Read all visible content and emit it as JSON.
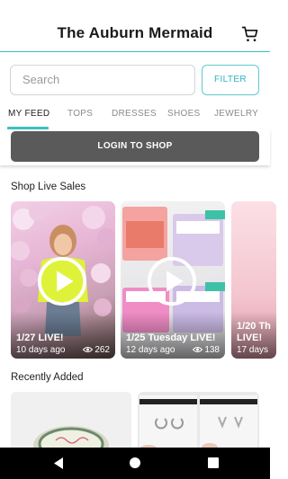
{
  "header": {
    "title": "The Auburn Mermaid",
    "cart_icon": "cart-icon"
  },
  "search": {
    "placeholder": "Search",
    "filter_label": "FILTER"
  },
  "tabs": [
    {
      "label": "MY FEED",
      "active": true
    },
    {
      "label": "TOPS",
      "active": false
    },
    {
      "label": "DRESSES",
      "active": false
    },
    {
      "label": "SHOES",
      "active": false
    },
    {
      "label": "JEWELRY",
      "active": false
    }
  ],
  "login": {
    "label": "LOGIN TO SHOP"
  },
  "live_sales": {
    "title": "Shop Live Sales",
    "cards": [
      {
        "title": "1/27 LIVE!",
        "age": "10 days ago",
        "views": "262"
      },
      {
        "title": "1/25 Tuesday LIVE!",
        "age": "12 days ago",
        "views": "138"
      },
      {
        "title": "1/20 Th LIVE!",
        "age": "17 days",
        "views": ""
      }
    ]
  },
  "recently_added": {
    "title": "Recently Added"
  },
  "colors": {
    "accent": "#3cc0c0",
    "login_button": "#5a5a5a",
    "nav_bar": "#000000"
  }
}
